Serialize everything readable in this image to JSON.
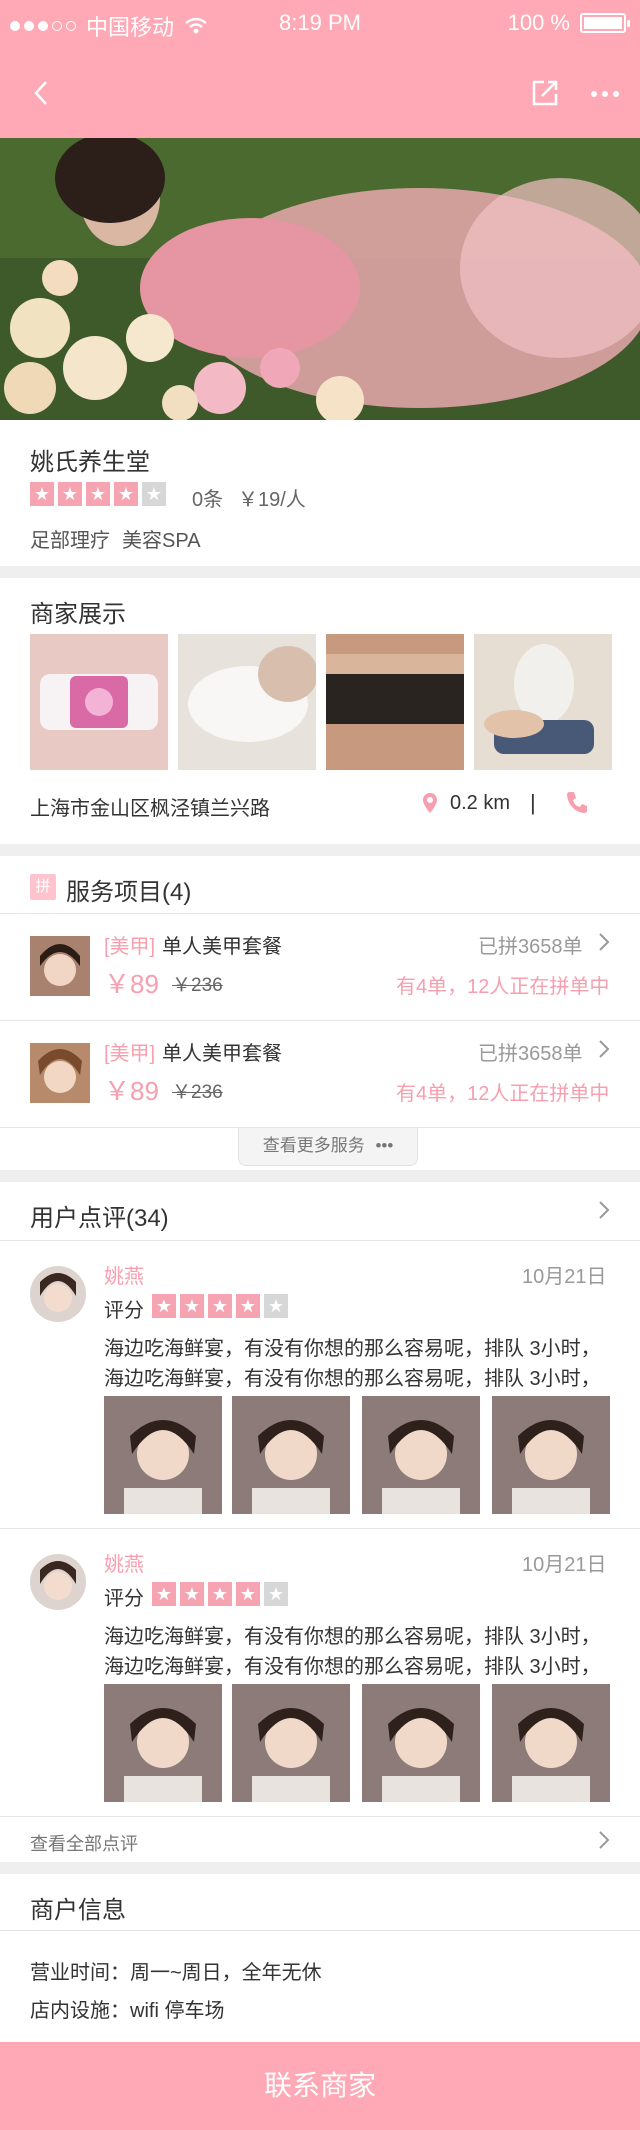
{
  "status_bar": {
    "carrier": "中国移动",
    "time": "8:19 PM",
    "battery": "100 %"
  },
  "nav": {
    "back_icon": "chevron-left-icon",
    "share_icon": "share-icon",
    "more_icon": "more-icon"
  },
  "store": {
    "name": "姚氏养生堂",
    "rating": 4,
    "review_count": "0条",
    "price": "￥19/人",
    "tags": [
      "足部理疗",
      "美容SPA"
    ]
  },
  "gallery": {
    "title": "商家展示",
    "address": "上海市金山区枫泾镇兰兴路",
    "distance": "0.2 km",
    "separator": "|"
  },
  "services": {
    "badge": "拼",
    "title": "服务项目(4)",
    "items": [
      {
        "category": "[美甲]",
        "name": "单人美甲套餐",
        "price": "￥89",
        "old_price": "￥236",
        "sold": "已拼3658单",
        "progress": "有4单，12人正在拼单中"
      },
      {
        "category": "[美甲]",
        "name": "单人美甲套餐",
        "price": "￥89",
        "old_price": "￥236",
        "sold": "已拼3658单",
        "progress": "有4单，12人正在拼单中"
      }
    ],
    "more_label": "查看更多服务",
    "more_dots": "•••"
  },
  "reviews": {
    "title": "用户点评(34)",
    "score_label": "评分",
    "items": [
      {
        "user": "姚燕",
        "date": "10月21日",
        "rating": 4,
        "text1": "海边吃海鲜宴，有没有你想的那么容易呢，排队 3小时，",
        "text2": "海边吃海鲜宴，有没有你想的那么容易呢，排队 3小时，"
      },
      {
        "user": "姚燕",
        "date": "10月21日",
        "rating": 4,
        "text1": "海边吃海鲜宴，有没有你想的那么容易呢，排队 3小时，",
        "text2": "海边吃海鲜宴，有没有你想的那么容易呢，排队 3小时，"
      }
    ],
    "all_label": "查看全部点评"
  },
  "merchant": {
    "title": "商户信息",
    "hours": "营业时间：周一~周日，全年无休",
    "facilities": "店内设施：wifi  停车场"
  },
  "footer": {
    "contact_label": "联系商家"
  },
  "colors": {
    "accent": "#ffa8b6",
    "pink_text": "#f79fae",
    "star_off": "#d7d7d7"
  }
}
